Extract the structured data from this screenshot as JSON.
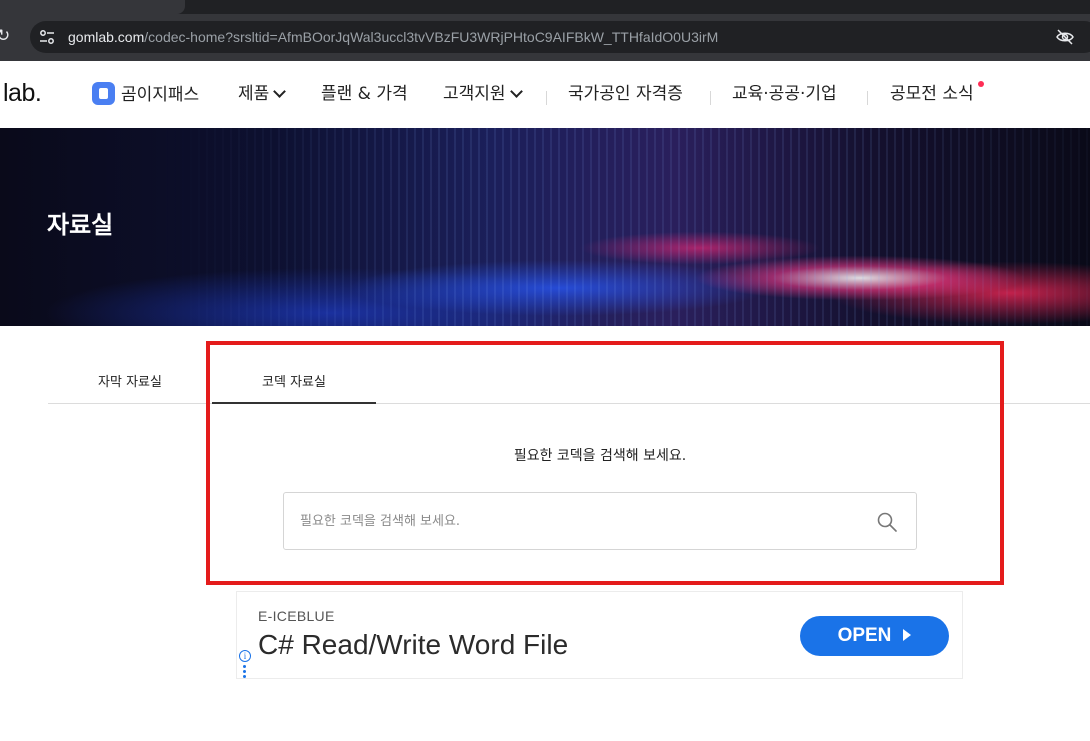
{
  "browser": {
    "url_host": "gomlab.com",
    "url_path": "/codec-home?srsltid=AfmBOorJqWal3uccl3tvVBzFU3WRjPHtoC9AIFBkW_TTHfaIdO0U3irM"
  },
  "nav": {
    "logo": "lab.",
    "gomi_pass": "곰이지패스",
    "products": "제품",
    "plans": "플랜 & 가격",
    "support": "고객지원",
    "certification": "국가공인 자격증",
    "education": "교육·공공·기업",
    "contest": "공모전 소식"
  },
  "banner": {
    "title": "자료실"
  },
  "tabs": [
    {
      "label": "자막 자료실",
      "active": false
    },
    {
      "label": "코덱 자료실",
      "active": true
    }
  ],
  "search": {
    "heading": "필요한 코덱을 검색해 보세요.",
    "placeholder": "필요한 코덱을 검색해 보세요.",
    "value": ""
  },
  "ad": {
    "brand": "E-ICEBLUE",
    "headline": "C# Read/Write Word File",
    "cta": "OPEN"
  },
  "colors": {
    "highlight": "#e41b1b",
    "ad_button": "#1a73e8",
    "notification_dot": "#ff2d55",
    "gomi_icon": "#4a7ff2"
  }
}
